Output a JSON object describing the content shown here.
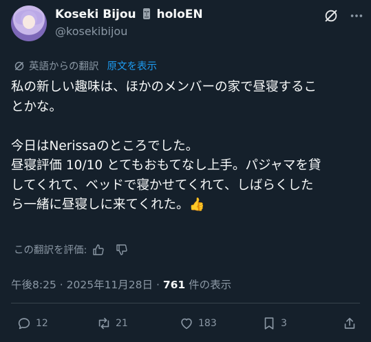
{
  "author": {
    "display_name": "Koseki Bijou",
    "name_suffix": "holoEN",
    "handle": "@kosekibijou"
  },
  "translation": {
    "label": "英語からの翻訳",
    "show_original": "原文を表示",
    "rate_prompt": "この翻訳を評価:"
  },
  "post": {
    "lines": [
      "私の新しい趣味は、ほかのメンバーの家で昼寝するこ",
      "とかな。",
      "",
      "今日はNerissaのところでした。",
      "昼寝評価 10/10 とてもおもてなし上手。パジャマを貸",
      "してくれて、ベッドで寝かせてくれて、しばらくした",
      "ら一緒に昼寝しに来てくれた。👍"
    ]
  },
  "meta": {
    "time": "午後8:25",
    "sep1": "·",
    "date": "2025年11月28日",
    "sep2": "·",
    "views": "761",
    "views_label": "件の表示"
  },
  "actions": {
    "replies": "12",
    "reposts": "21",
    "likes": "183",
    "bookmarks": "3"
  },
  "colors": {
    "background": "#15202b",
    "text": "#f7f9f9",
    "muted": "#8b98a5",
    "link": "#1d9bf0"
  }
}
